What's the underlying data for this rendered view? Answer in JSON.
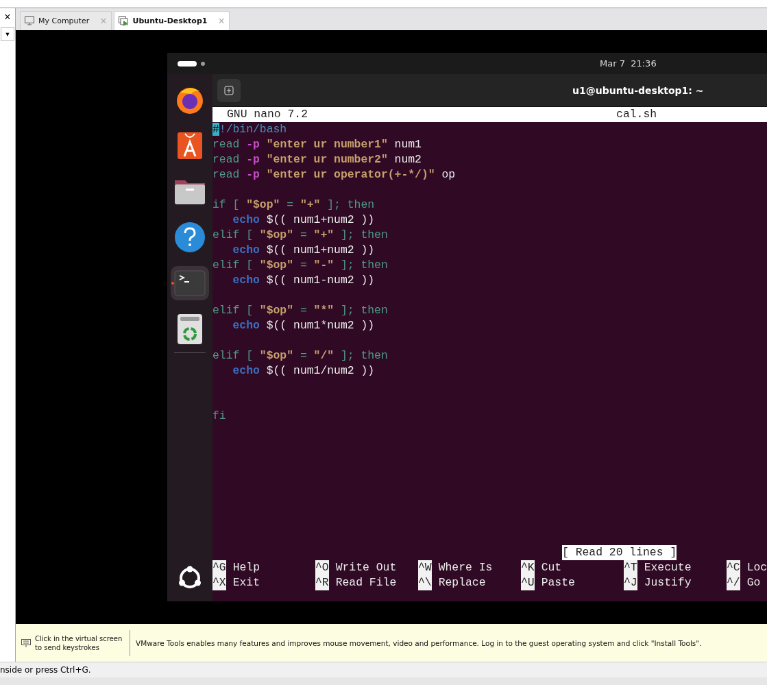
{
  "vm_sidebar": {
    "close": "×",
    "dropdown": "▼"
  },
  "tabs": [
    {
      "kind": "computer",
      "label": "My Computer",
      "selected": false,
      "close": "×"
    },
    {
      "kind": "vm",
      "label": "Ubuntu-Desktop1",
      "selected": true,
      "close": "×"
    }
  ],
  "guest": {
    "clock": "Mar 7  21:36",
    "dock": [
      {
        "kind": "firefox",
        "active": false
      },
      {
        "kind": "app-center",
        "active": false
      },
      {
        "kind": "files",
        "active": false
      },
      {
        "kind": "help",
        "active": false
      },
      {
        "kind": "terminal",
        "active": true
      },
      {
        "kind": "trash",
        "active": false
      }
    ],
    "terminal": {
      "title": "u1@ubuntu-desktop1: ~",
      "nano": {
        "version": "GNU nano 7.2",
        "file": "cal.sh",
        "lines": [
          {
            "segments": [
              {
                "t": "#",
                "kind": "cursor"
              },
              {
                "t": "!/bin/bash",
                "kind": "shebang"
              }
            ]
          },
          {
            "segments": [
              {
                "t": "read ",
                "kind": "kw"
              },
              {
                "t": "-p ",
                "kind": "flag"
              },
              {
                "t": "\"enter ur number1\"",
                "kind": "str"
              },
              {
                "t": " num1",
                "kind": "plain"
              }
            ]
          },
          {
            "segments": [
              {
                "t": "read ",
                "kind": "kw"
              },
              {
                "t": "-p ",
                "kind": "flag"
              },
              {
                "t": "\"enter ur number2\"",
                "kind": "str"
              },
              {
                "t": " num2",
                "kind": "plain"
              }
            ]
          },
          {
            "segments": [
              {
                "t": "read ",
                "kind": "kw"
              },
              {
                "t": "-p ",
                "kind": "flag"
              },
              {
                "t": "\"enter ur operator(+-*/)\"",
                "kind": "str"
              },
              {
                "t": " op",
                "kind": "plain"
              }
            ]
          },
          {
            "blank": true
          },
          {
            "segments": [
              {
                "t": "if [ ",
                "kind": "kw"
              },
              {
                "t": "\"$op\"",
                "kind": "str"
              },
              {
                "t": " = ",
                "kind": "kw"
              },
              {
                "t": "\"+\"",
                "kind": "str"
              },
              {
                "t": " ]; then",
                "kind": "kw"
              }
            ]
          },
          {
            "segments": [
              {
                "t": "   echo",
                "kind": "builtin"
              },
              {
                "t": " $(( num1+num2 ))",
                "kind": "plain"
              }
            ]
          },
          {
            "segments": [
              {
                "t": "elif [ ",
                "kind": "kw"
              },
              {
                "t": "\"$op\"",
                "kind": "str"
              },
              {
                "t": " = ",
                "kind": "kw"
              },
              {
                "t": "\"+\"",
                "kind": "str"
              },
              {
                "t": " ]; then",
                "kind": "kw"
              }
            ]
          },
          {
            "segments": [
              {
                "t": "   echo",
                "kind": "builtin"
              },
              {
                "t": " $(( num1+num2 ))",
                "kind": "plain"
              }
            ]
          },
          {
            "segments": [
              {
                "t": "elif [ ",
                "kind": "kw"
              },
              {
                "t": "\"$op\"",
                "kind": "str"
              },
              {
                "t": " = ",
                "kind": "kw"
              },
              {
                "t": "\"-\"",
                "kind": "str"
              },
              {
                "t": " ]; then",
                "kind": "kw"
              }
            ]
          },
          {
            "segments": [
              {
                "t": "   echo",
                "kind": "builtin"
              },
              {
                "t": " $(( num1-num2 ))",
                "kind": "plain"
              }
            ]
          },
          {
            "blank": true
          },
          {
            "segments": [
              {
                "t": "elif [ ",
                "kind": "kw"
              },
              {
                "t": "\"$op\"",
                "kind": "str"
              },
              {
                "t": " = ",
                "kind": "kw"
              },
              {
                "t": "\"*\"",
                "kind": "str"
              },
              {
                "t": " ]; then",
                "kind": "kw"
              }
            ]
          },
          {
            "segments": [
              {
                "t": "   echo",
                "kind": "builtin"
              },
              {
                "t": " $(( num1*num2 ))",
                "kind": "plain"
              }
            ]
          },
          {
            "blank": true
          },
          {
            "segments": [
              {
                "t": "elif [ ",
                "kind": "kw"
              },
              {
                "t": "\"$op\"",
                "kind": "str"
              },
              {
                "t": " = ",
                "kind": "kw"
              },
              {
                "t": "\"/\"",
                "kind": "str"
              },
              {
                "t": " ]; then",
                "kind": "kw"
              }
            ]
          },
          {
            "segments": [
              {
                "t": "   echo",
                "kind": "builtin"
              },
              {
                "t": " $(( num1/num2 ))",
                "kind": "plain"
              }
            ]
          },
          {
            "blank": true
          },
          {
            "blank": true
          },
          {
            "segments": [
              {
                "t": "fi",
                "kind": "kw"
              }
            ]
          }
        ],
        "status": "[ Read 20 lines ]",
        "shortcuts": [
          [
            {
              "key": "^G",
              "label": "Help"
            },
            {
              "key": "^X",
              "label": "Exit"
            }
          ],
          [
            {
              "key": "^O",
              "label": "Write Out"
            },
            {
              "key": "^R",
              "label": "Read File"
            }
          ],
          [
            {
              "key": "^W",
              "label": "Where Is"
            },
            {
              "key": "^\\",
              "label": "Replace"
            }
          ],
          [
            {
              "key": "^K",
              "label": "Cut"
            },
            {
              "key": "^U",
              "label": "Paste"
            }
          ],
          [
            {
              "key": "^T",
              "label": "Execute"
            },
            {
              "key": "^J",
              "label": "Justify"
            }
          ],
          [
            {
              "key": "^C",
              "label": "Loc"
            },
            {
              "key": "^/",
              "label": "Go"
            }
          ]
        ]
      }
    }
  },
  "info_bar": {
    "hint": "Click in the virtual screen to send keystrokes",
    "message": "VMware Tools enables many features and improves mouse movement, video and performance. Log in to the guest operating system and click \"Install Tools\"."
  },
  "status_bar": "nside or press Ctrl+G."
}
